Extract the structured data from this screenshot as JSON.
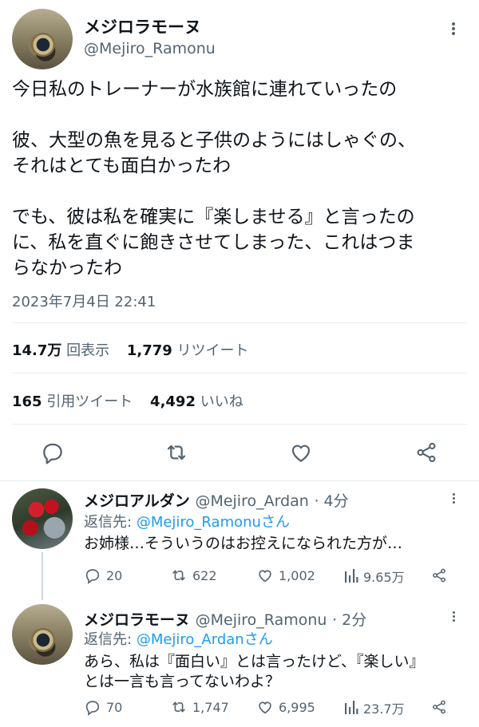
{
  "tweet": {
    "author_name": "メジロラモーヌ",
    "author_handle": "@Mejiro_Ramonu",
    "text": "今日私のトレーナーが水族館に連れていったの\n\n彼、大型の魚を見ると子供のようにはしゃぐの、\nそれはとても面白かったわ\n\nでも、彼は私を確実に『楽しませる』と言ったの\nに、私を直ぐに飽きさせてしまった、これはつま\nらなかったわ",
    "timestamp": "2023年7月4日 22:41",
    "views_count": "14.7万",
    "views_label": "回表示",
    "retweets_count": "1,779",
    "retweets_label": "リツイート",
    "quotes_count": "165",
    "quotes_label": "引用ツイート",
    "likes_count": "4,492",
    "likes_label": "いいね",
    "icons": [
      "more-icon",
      "reply-icon",
      "retweet-icon",
      "like-icon",
      "share-icon"
    ]
  },
  "replies": [
    {
      "name": "メジロアルダン",
      "handle": "@Mejiro_Ardan",
      "time": "· 4分",
      "reply_to_label": "返信先:",
      "reply_to": "@Mejiro_Ramonuさん",
      "text": "お姉様…そういうのはお控えになられた方が…",
      "reply_count": "20",
      "retweet_count": "622",
      "like_count": "1,002",
      "view_count": "9.65万"
    },
    {
      "name": "メジロラモーヌ",
      "handle": "@Mejiro_Ramonu",
      "time": "· 2分",
      "reply_to_label": "返信先:",
      "reply_to": "@Mejiro_Ardanさん",
      "text": "あら、私は『面白い』とは言ったけど、『楽しい』\nとは一言も言ってないわよ？",
      "reply_count": "70",
      "retweet_count": "1,747",
      "like_count": "6,995",
      "view_count": "23.7万"
    }
  ],
  "colors": {
    "accent": "#1d9bf0",
    "secondary_text": "#536471",
    "divider": "#e6ecf0"
  }
}
